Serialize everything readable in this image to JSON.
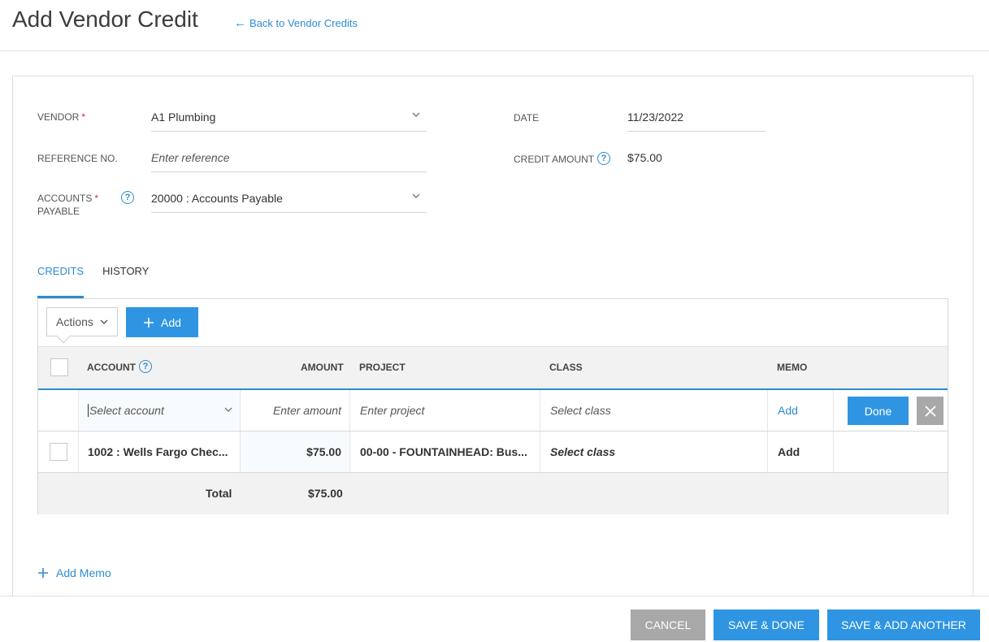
{
  "header": {
    "title": "Add Vendor Credit",
    "back_link": "Back to Vendor Credits"
  },
  "form": {
    "vendor": {
      "label": "VENDOR",
      "required_mark": "*",
      "value": "A1 Plumbing"
    },
    "reference": {
      "label": "REFERENCE NO.",
      "placeholder": "Enter reference"
    },
    "accounts_payable": {
      "label_line1": "ACCOUNTS",
      "label_line2": "PAYABLE",
      "required_mark": "*",
      "value": "20000 : Accounts Payable"
    },
    "date": {
      "label": "DATE",
      "value": "11/23/2022"
    },
    "credit_amount": {
      "label": "CREDIT AMOUNT",
      "value": "$75.00"
    }
  },
  "tabs": [
    {
      "label": "CREDITS",
      "active": true
    },
    {
      "label": "HISTORY",
      "active": false
    }
  ],
  "toolbar": {
    "actions_label": "Actions",
    "add_label": "Add"
  },
  "table": {
    "columns": {
      "account": "ACCOUNT",
      "amount": "AMOUNT",
      "project": "PROJECT",
      "class": "CLASS",
      "memo": "MEMO"
    },
    "edit_row": {
      "account_placeholder": "Select account",
      "amount_placeholder": "Enter amount",
      "project_placeholder": "Enter project",
      "class_placeholder": "Select class",
      "memo_link": "Add",
      "done_label": "Done"
    },
    "rows": [
      {
        "account": "1002 : Wells Fargo Chec...",
        "amount": "$75.00",
        "project": "00-00 - FOUNTAINHEAD: Bus...",
        "class": "Select class",
        "memo": "Add"
      }
    ],
    "total": {
      "label": "Total",
      "amount": "$75.00"
    }
  },
  "add_memo_label": "Add Memo",
  "footer": {
    "cancel": "CANCEL",
    "save_done": "SAVE & DONE",
    "save_add": "SAVE & ADD ANOTHER"
  },
  "colors": {
    "accent": "#2f95e2",
    "link": "#2d8ccf",
    "required": "#e0233b",
    "cancel_button": "#a8a8a8"
  }
}
